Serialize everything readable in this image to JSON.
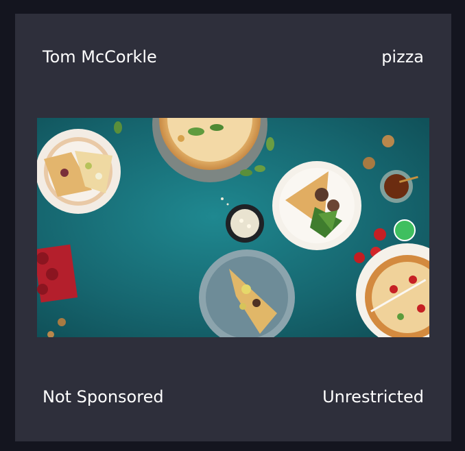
{
  "card": {
    "author": "Tom McCorkle",
    "tag": "pizza",
    "sponsorship": "Not Sponsored",
    "usage_rights": "Unrestricted"
  },
  "image": {
    "subject": "pizza",
    "status_color": "#3fbf5f"
  },
  "colors": {
    "page_background": "#14151f",
    "card_background": "#2e2f3b",
    "text": "#ffffff",
    "status_green": "#3fbf5f",
    "table_teal": "#19727b"
  }
}
